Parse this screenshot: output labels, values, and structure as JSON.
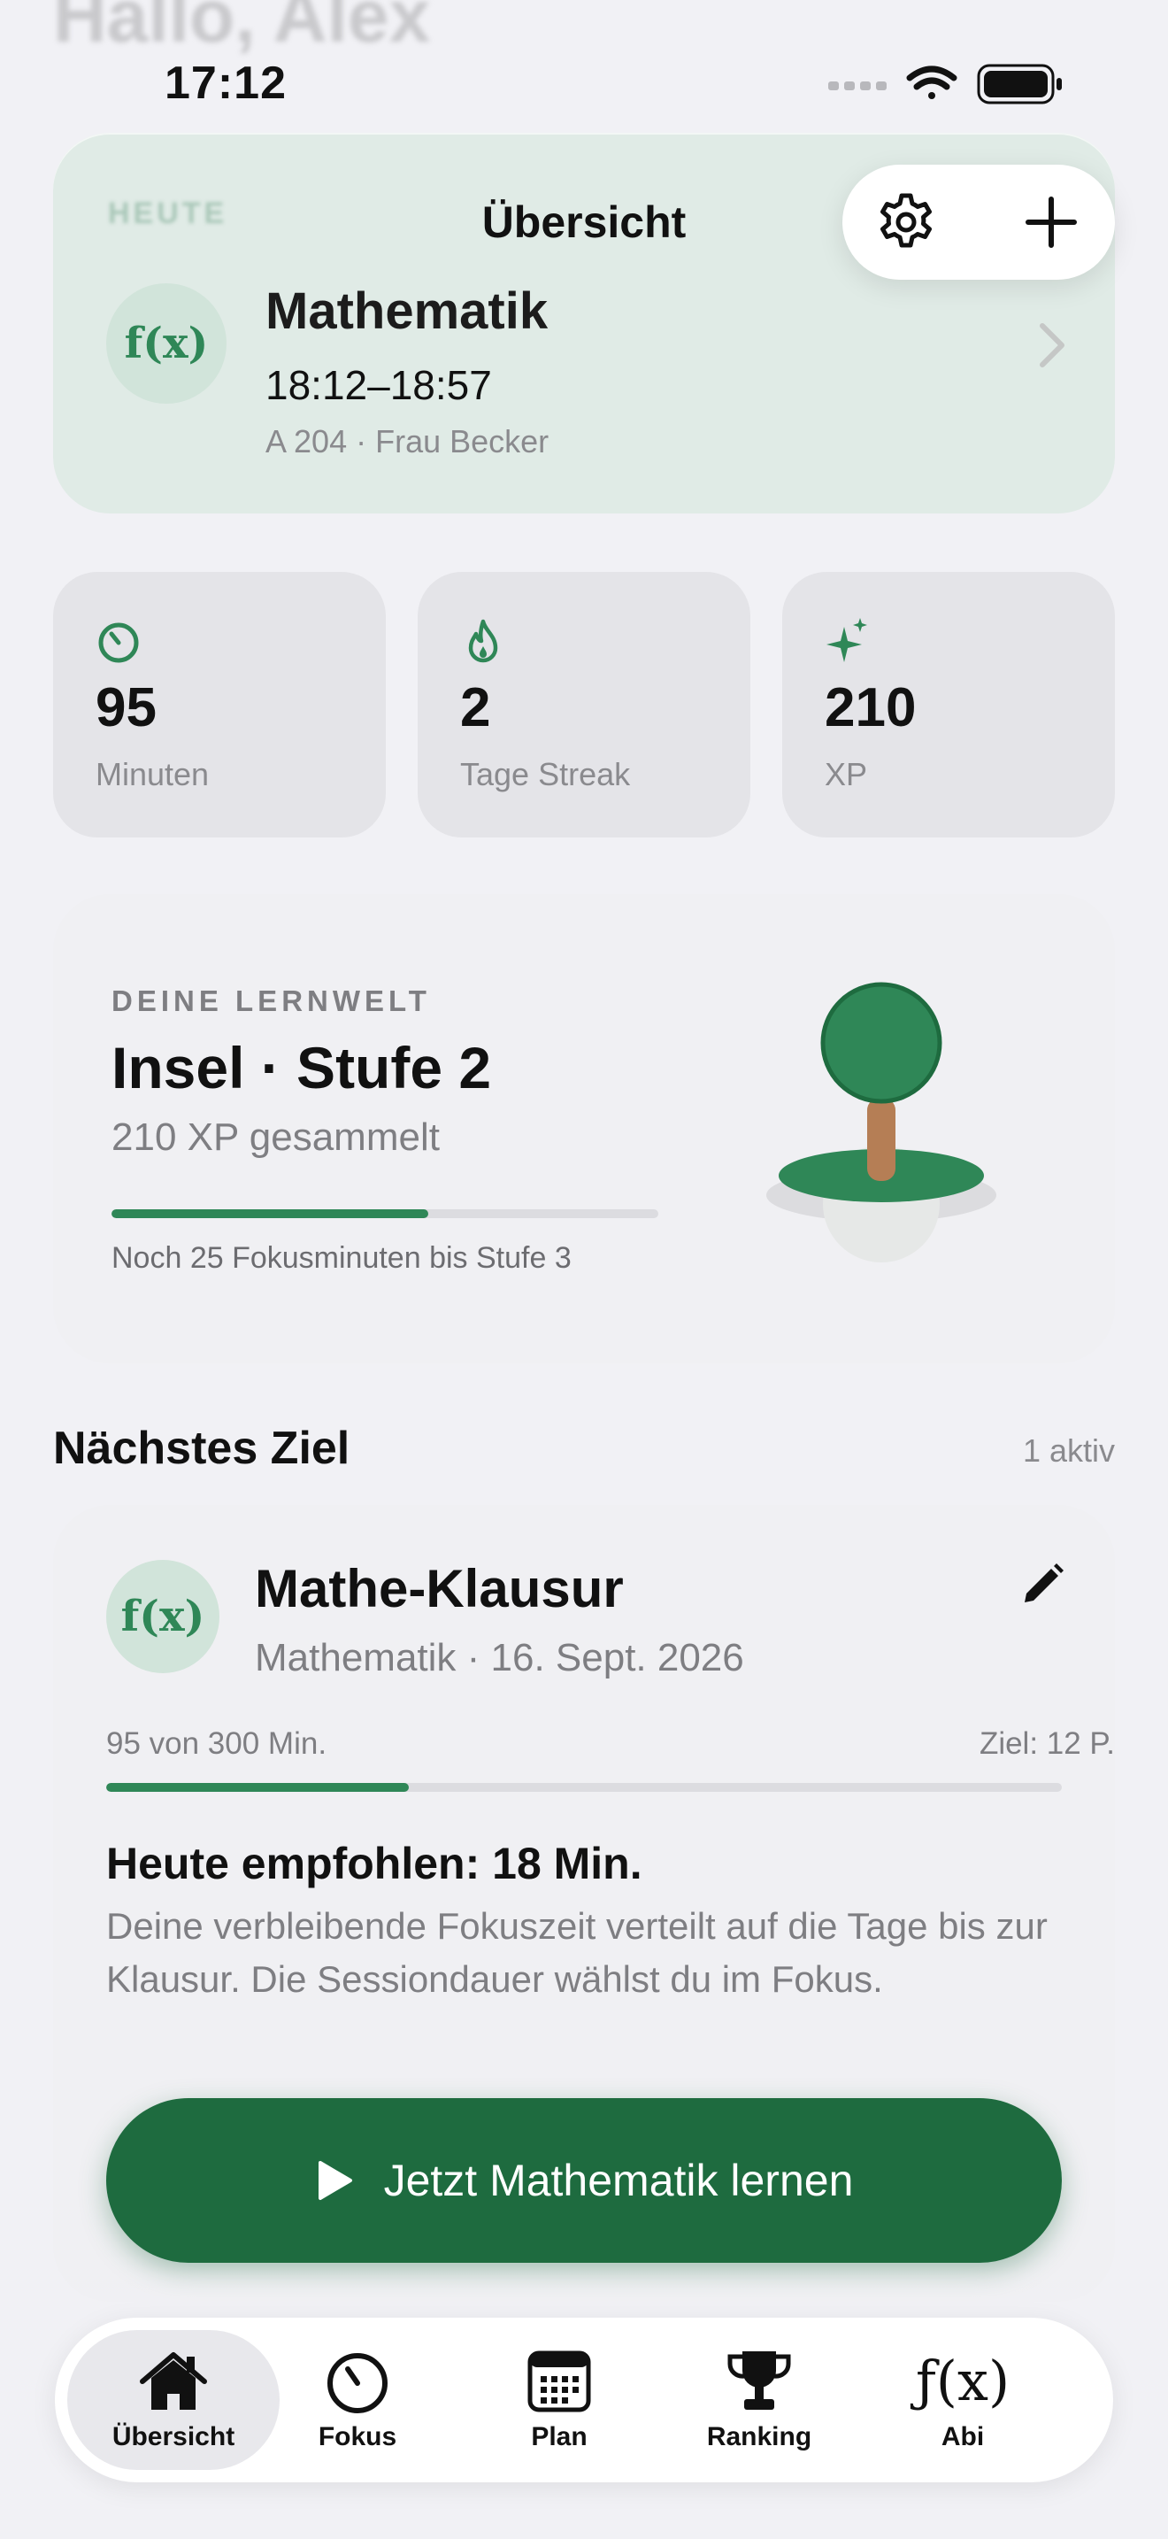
{
  "header": {
    "ghost_greeting": "Hallo, Alex",
    "nav_title": "Übersicht",
    "status_time": "17:12"
  },
  "today": {
    "tag": "HEUTE",
    "icon": "f(x)",
    "subject": "Mathematik",
    "time": "18:12–18:57",
    "room": "A 204 · Frau Becker"
  },
  "stats": [
    {
      "icon": "timer-icon",
      "value": "95",
      "label": "Minuten"
    },
    {
      "icon": "flame-icon",
      "value": "2",
      "label": "Tage Streak"
    },
    {
      "icon": "sparkle-icon",
      "value": "210",
      "label": "XP"
    }
  ],
  "world": {
    "eyebrow": "DEINE LERNWELT",
    "title": "Insel · Stufe 2",
    "xp": "210 XP gesammelt",
    "progress": 0.58,
    "hint": "Noch 25 Fokusminuten bis Stufe 3"
  },
  "goal_section": {
    "title": "Nächstes Ziel",
    "count": "1 aktiv"
  },
  "goal": {
    "icon": "f(x)",
    "title": "Mathe-Klausur",
    "meta": "Mathematik · 16. Sept. 2026",
    "progress_left": "95 von 300 Min.",
    "progress_right": "Ziel: 12 P.",
    "progress": 0.3167,
    "recommendation": "Heute empfohlen: 18 Min.",
    "description": "Deine verbleibende Fokuszeit verteilt auf die Tage bis zur Klausur. Die Sessiondauer wählst du im Fokus."
  },
  "cta": {
    "label": "Jetzt Mathematik lernen"
  },
  "tabs": [
    {
      "label": "Übersicht",
      "icon": "house-icon",
      "active": true
    },
    {
      "label": "Fokus",
      "icon": "timer-icon",
      "active": false
    },
    {
      "label": "Plan",
      "icon": "calendar-icon",
      "active": false
    },
    {
      "label": "Ranking",
      "icon": "trophy-icon",
      "active": false
    },
    {
      "label": "Abi",
      "icon": "function-icon",
      "active": false
    }
  ],
  "colors": {
    "accent": "#2f8757",
    "cta": "#1e6b3f",
    "today_card": "#e0ebe6"
  }
}
